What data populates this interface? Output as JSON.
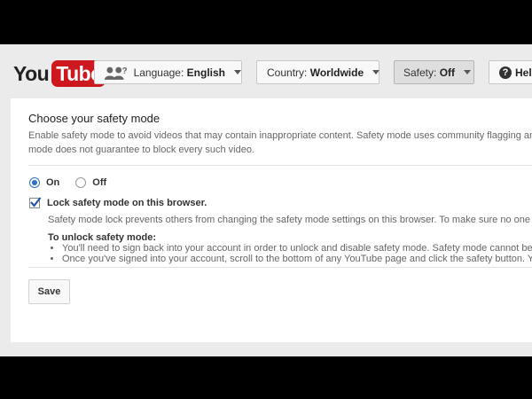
{
  "header": {
    "logo_you": "You",
    "logo_tube": "Tube",
    "language_label": "Language:",
    "language_value": "English",
    "country_label": "Country:",
    "country_value": "Worldwide",
    "safety_label": "Safety:",
    "safety_value": "Off",
    "help_label": "Help"
  },
  "safety_mode": {
    "title": "Choose your safety mode",
    "description_line1": "Enable safety mode to avoid videos that may contain inappropriate content. Safety mode uses community flagging and other signals to identify and filter out inappropriate content.",
    "description_line2": "mode does not guarantee to block every such video.",
    "option_on": "On",
    "option_off": "Off",
    "selected": "On",
    "lock_label": "Lock safety mode on this browser.",
    "lock_checked": true,
    "lock_description": "Safety mode lock prevents others from changing the safety mode settings on this browser. To make sure no one can change it,",
    "unlock_heading": "To unlock safety mode:",
    "unlock_steps": [
      "You'll need to sign back into your account in order to unlock and disable safety mode. Safety mode cannot be unlocked",
      "Once you've signed into your account, scroll to the bottom of any YouTube page and click the safety button. You'll"
    ],
    "save_label": "Save"
  },
  "colors": {
    "brand_red": "#cc181e",
    "accent_blue": "#2d6fc9"
  }
}
